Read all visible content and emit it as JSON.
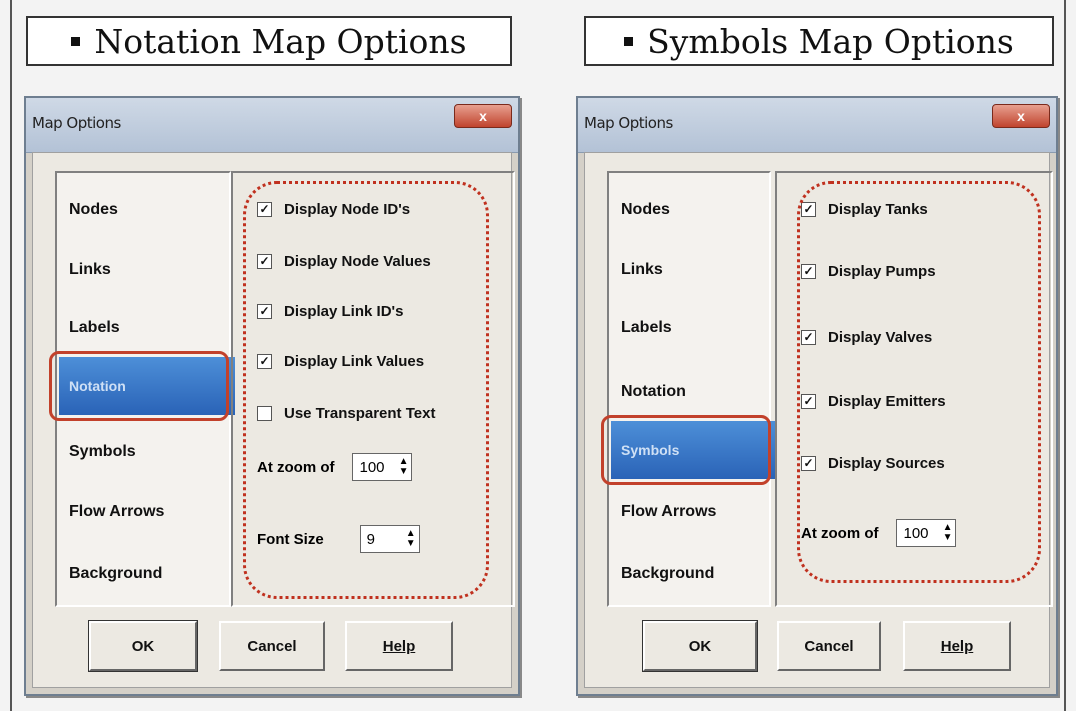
{
  "left_panel": {
    "heading": "Notation Map Options",
    "dialog_title": "Map Options",
    "close_label": "x",
    "sidebar_items": [
      "Nodes",
      "Links",
      "Labels",
      "Notation",
      "Symbols",
      "Flow Arrows",
      "Background"
    ],
    "selected_label": "Notation",
    "options": [
      {
        "label": "Display Node ID's",
        "checked": true
      },
      {
        "label": "Display Node Values",
        "checked": true
      },
      {
        "label": "Display Link ID's",
        "checked": true
      },
      {
        "label": "Display Link Values",
        "checked": true
      },
      {
        "label": "Use Transparent Text",
        "checked": false
      }
    ],
    "zoom_label": "At zoom of",
    "zoom_value": "100",
    "font_label": "Font Size",
    "font_value": "9",
    "buttons": {
      "ok": "OK",
      "cancel": "Cancel",
      "help": "Help"
    }
  },
  "right_panel": {
    "heading": "Symbols Map Options",
    "dialog_title": "Map Options",
    "close_label": "x",
    "sidebar_items": [
      "Nodes",
      "Links",
      "Labels",
      "Notation",
      "Symbols",
      "Flow Arrows",
      "Background"
    ],
    "selected_label": "Symbols",
    "options": [
      {
        "label": "Display Tanks",
        "checked": true
      },
      {
        "label": "Display Pumps",
        "checked": true
      },
      {
        "label": "Display Valves",
        "checked": true
      },
      {
        "label": "Display Emitters",
        "checked": true
      },
      {
        "label": "Display Sources",
        "checked": true
      }
    ],
    "zoom_label": "At zoom of",
    "zoom_value": "100",
    "buttons": {
      "ok": "OK",
      "cancel": "Cancel",
      "help": "Help"
    }
  },
  "colors": {
    "highlight": "#c2412b",
    "selection": "#2a63b7"
  }
}
